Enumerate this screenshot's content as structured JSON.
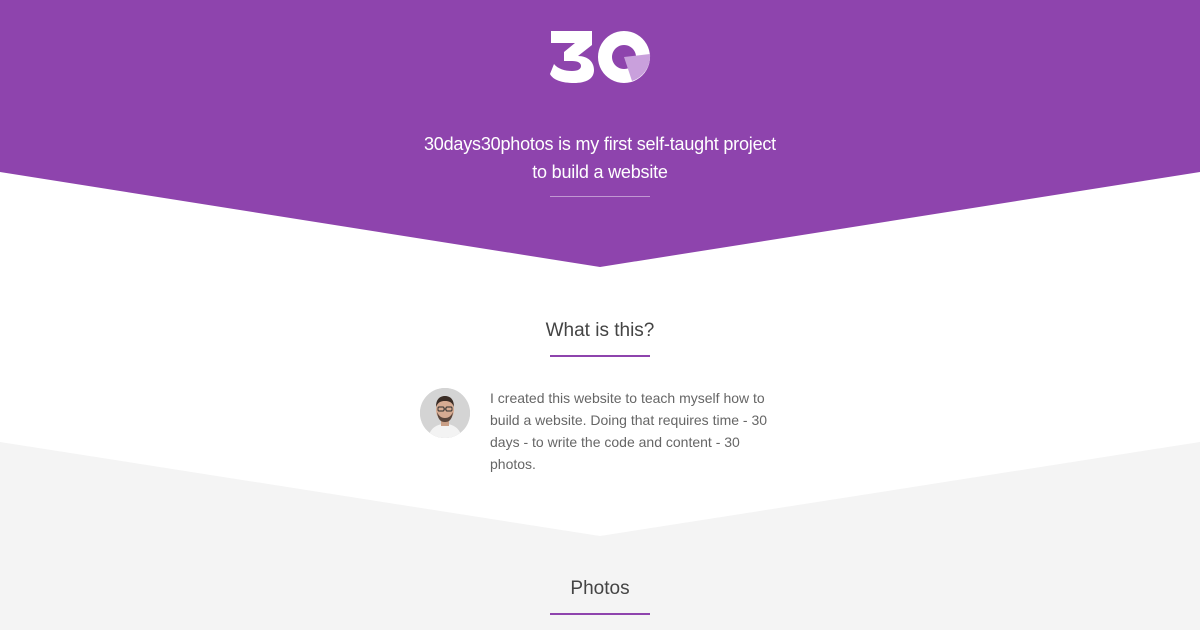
{
  "colors": {
    "brand": "#8e44ad",
    "section_bg": "#f4f4f4",
    "text_dark": "#444444",
    "text_body": "#666666"
  },
  "header": {
    "logo_icon": "30-logo-icon",
    "tagline_line1": "30days30photos is my first self-taught project",
    "tagline_line2": "to build a website"
  },
  "about": {
    "title": "What is this?",
    "avatar_icon": "author-avatar",
    "body": "I created this website to teach myself how to build a website. Doing that requires time - 30 days - to write the code and content - 30 photos."
  },
  "photos": {
    "title": "Photos"
  }
}
